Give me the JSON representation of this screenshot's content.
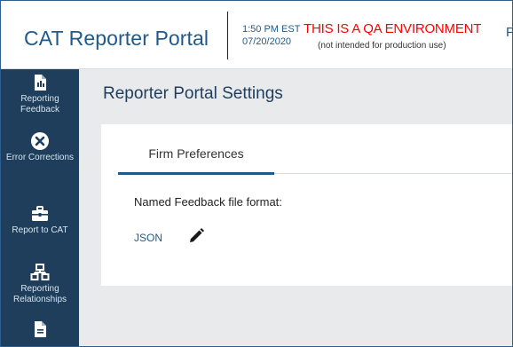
{
  "header": {
    "app_title": "CAT Reporter Portal",
    "time": "1:50 PM EST",
    "date": "07/20/2020",
    "qa_banner": "THIS IS A QA ENVIRONMENT",
    "qa_subtext": "(not intended for production use)",
    "trailing_text": "P"
  },
  "sidebar": {
    "items": [
      {
        "label": "Reporting Feedback",
        "icon": "document-icon"
      },
      {
        "label": "Error Corrections",
        "icon": "error-x-icon"
      },
      {
        "label": "Report to CAT",
        "icon": "briefcase-icon"
      },
      {
        "label": "Reporting Relationships",
        "icon": "hierarchy-icon"
      },
      {
        "label": "",
        "icon": "document-icon"
      }
    ]
  },
  "main": {
    "page_title": "Reporter Portal Settings",
    "tabs": [
      {
        "label": "Firm Preferences",
        "active": true
      }
    ],
    "field_label": "Named Feedback file format:",
    "field_value": "JSON"
  },
  "colors": {
    "brand_blue": "#1f5a8a",
    "sidebar_bg": "#1e3e5c",
    "qa_red": "#ff0000",
    "main_bg": "#e9eaec"
  }
}
